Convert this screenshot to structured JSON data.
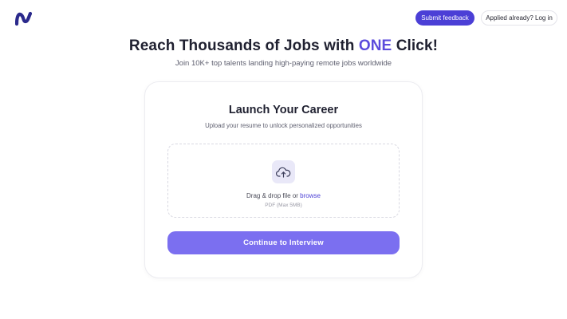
{
  "header": {
    "logo_icon": "brand-wave-logo",
    "feedback_label": "Submit feedback",
    "login_label": "Applied already? Log in"
  },
  "hero": {
    "title_before": "Reach Thousands of Jobs with ",
    "title_accent": "ONE",
    "title_after": " Click!",
    "subtitle": "Join 10K+ top talents landing high-paying remote jobs worldwide"
  },
  "card": {
    "title": "Launch Your Career",
    "subtitle": "Upload your resume to unlock personalized opportunities",
    "upload": {
      "icon": "cloud-upload-icon",
      "text": "Drag & drop file or ",
      "browse_label": "browse",
      "hint": "PDF (Max 5MB)"
    },
    "continue_label": "Continue to Interview"
  },
  "colors": {
    "brand": "#4b3fd6",
    "accent_text": "#5b4bdc",
    "continue_button": "#7b6ff0",
    "upload_icon_bg": "#e9e8f8"
  }
}
